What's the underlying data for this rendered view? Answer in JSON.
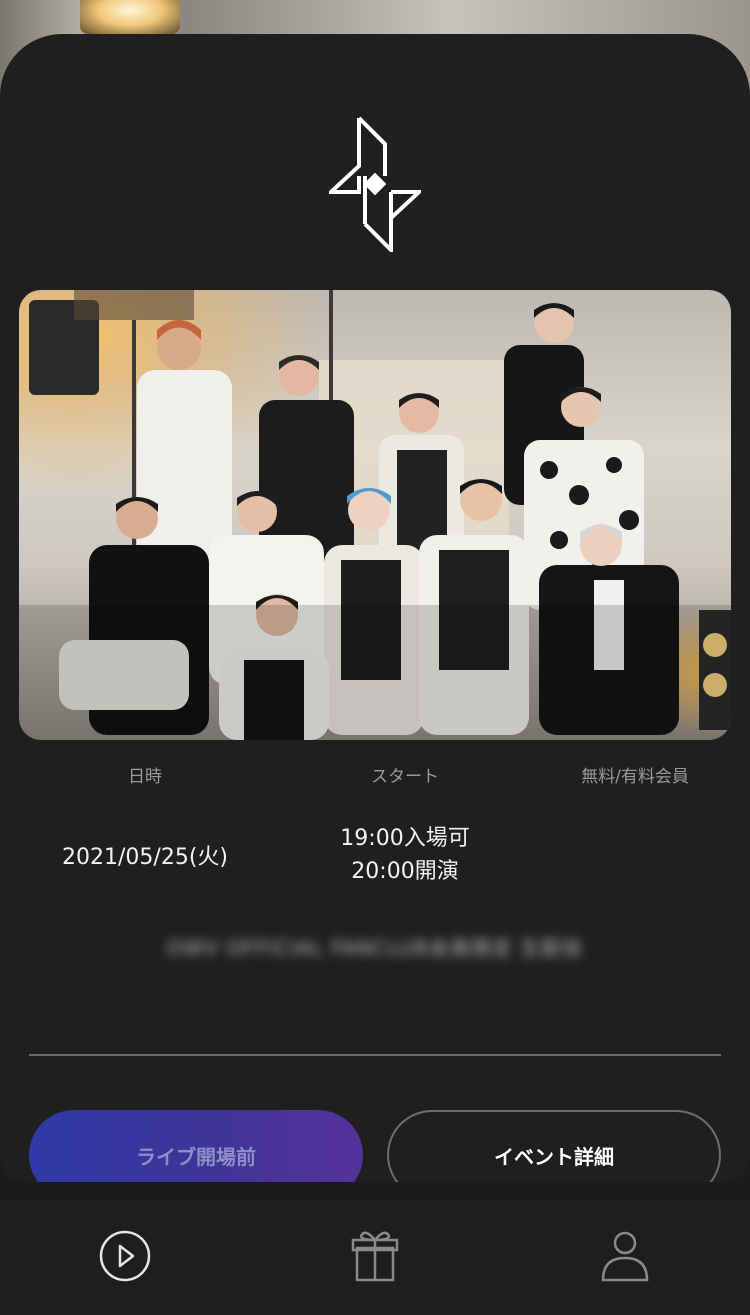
{
  "event": {
    "labels": {
      "date": "日時",
      "start": "スタート",
      "membership": "無料/有料会員"
    },
    "date": "2021/05/25(火)",
    "doors_open": "19:00入場可",
    "show_start": "20:00開演",
    "blurred_note": "OWV OFFICIAL FANCLUB会員限定 生配信"
  },
  "buttons": {
    "live_label": "ライブ開場前",
    "detail_label": "イベント詳細"
  },
  "tabbar": {
    "items": [
      {
        "name": "play",
        "icon": "play-circle-icon",
        "active": true
      },
      {
        "name": "gift",
        "icon": "gift-icon",
        "active": false
      },
      {
        "name": "account",
        "icon": "user-icon",
        "active": false
      }
    ]
  },
  "colors": {
    "background": "#1f1f1f",
    "accent_gradient_start": "#2f3aa8",
    "accent_gradient_end": "#55329b"
  }
}
